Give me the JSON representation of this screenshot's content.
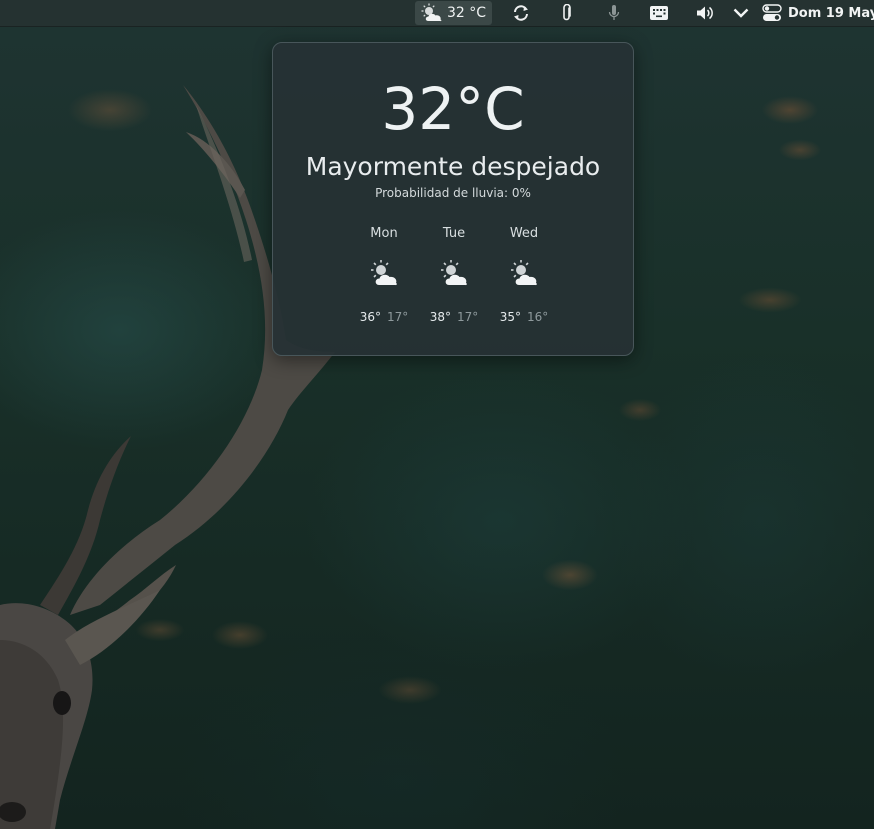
{
  "top_panel": {
    "weather": {
      "icon": "partly-cloudy-icon",
      "temperature": "32 °C"
    },
    "icons": [
      "refresh-icon",
      "paperclip-icon",
      "microphone-icon",
      "keyboard-icon",
      "volume-icon",
      "chevron-down-icon",
      "toggle-icon"
    ],
    "clock": "Dom 19 May"
  },
  "weather_popup": {
    "temperature": "32°C",
    "condition": "Mayormente despejado",
    "rain_chance": "Probabilidad de lluvia: 0%",
    "forecast": [
      {
        "day": "Mon",
        "icon": "partly-cloudy-icon",
        "high": "36°",
        "low": "17°"
      },
      {
        "day": "Tue",
        "icon": "partly-cloudy-icon",
        "high": "38°",
        "low": "17°"
      },
      {
        "day": "Wed",
        "icon": "partly-cloudy-icon",
        "high": "35°",
        "low": "16°"
      }
    ]
  },
  "colors": {
    "panel_bg": "#253231",
    "popup_bg": "#263134",
    "text": "#eef2f3",
    "muted_text": "#8f9a9d"
  }
}
